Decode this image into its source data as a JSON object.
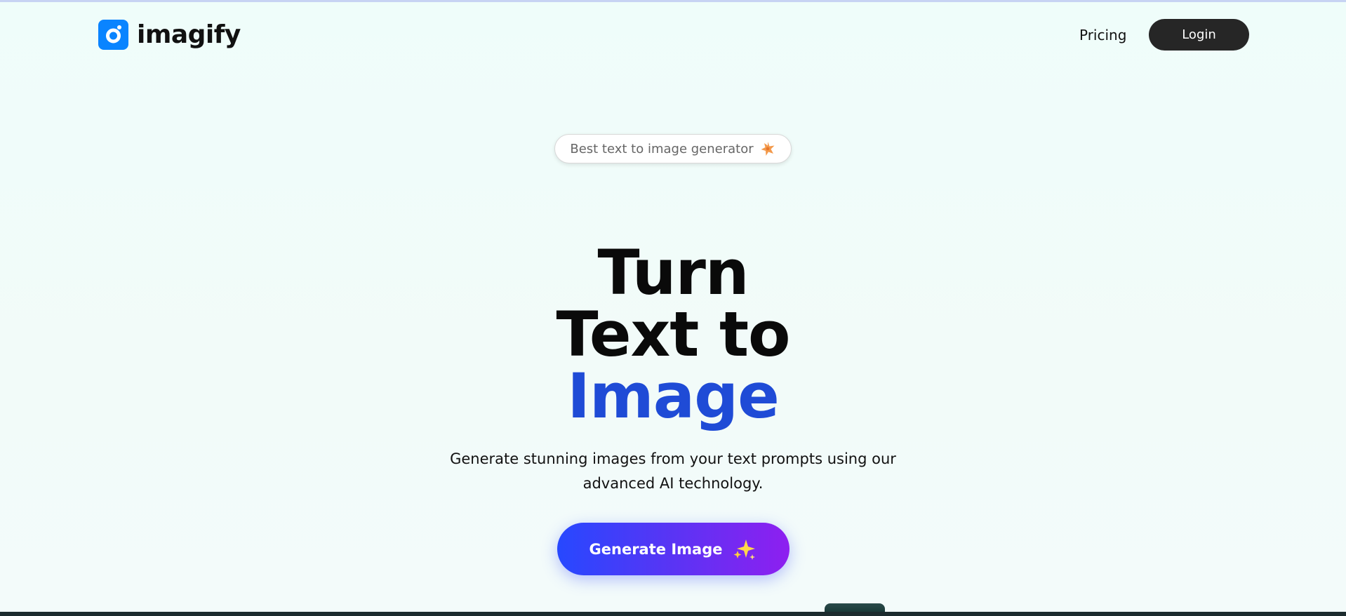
{
  "header": {
    "logo_text": "imagify",
    "nav": {
      "pricing_label": "Pricing",
      "login_label": "Login"
    }
  },
  "badge": {
    "text": "Best text to image generator",
    "icon": "star-burst-icon"
  },
  "hero": {
    "title_line1": "Turn",
    "title_line2": "Text to",
    "title_line3": "Image",
    "subtitle": "Generate stunning images from your text prompts using our advanced AI technology."
  },
  "cta": {
    "label": "Generate Image",
    "icon": "sparkles-icon"
  },
  "colors": {
    "accent": "#1f4bd6",
    "logo_blue": "#0a84ff",
    "login_bg": "#262626",
    "cta_gradient_start": "#2748ff",
    "cta_gradient_end": "#8e1ff0"
  }
}
